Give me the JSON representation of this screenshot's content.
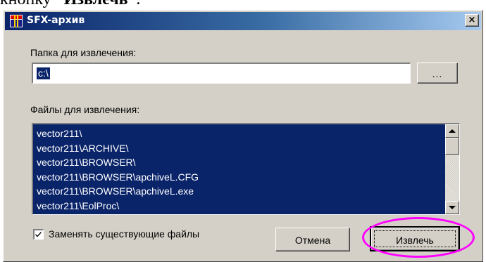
{
  "top_caption": {
    "prefix": "кнопку ",
    "bold": "“Извлечь”",
    "suffix": "."
  },
  "window": {
    "title": "SFX-архив",
    "close_label": "×"
  },
  "folder": {
    "label": "Папка для извлечения:",
    "value": "c:\\",
    "browse_label": "..."
  },
  "files": {
    "label": "Файлы для извлечения:",
    "items": [
      "vector211\\",
      "vector211\\ARCHIVE\\",
      "vector211\\BROWSER\\",
      "vector211\\BROWSER\\apchiveL.CFG",
      "vector211\\BROWSER\\apchiveL.exe",
      "vector211\\EolProc\\"
    ]
  },
  "replace_files": {
    "label": "Заменять существующие файлы",
    "checked": true
  },
  "buttons": {
    "cancel": "Отмена",
    "extract": "Извлечь"
  },
  "colors": {
    "selection": "#0a246a",
    "highlight": "#ff00ff",
    "face": "#d4d0c8"
  }
}
